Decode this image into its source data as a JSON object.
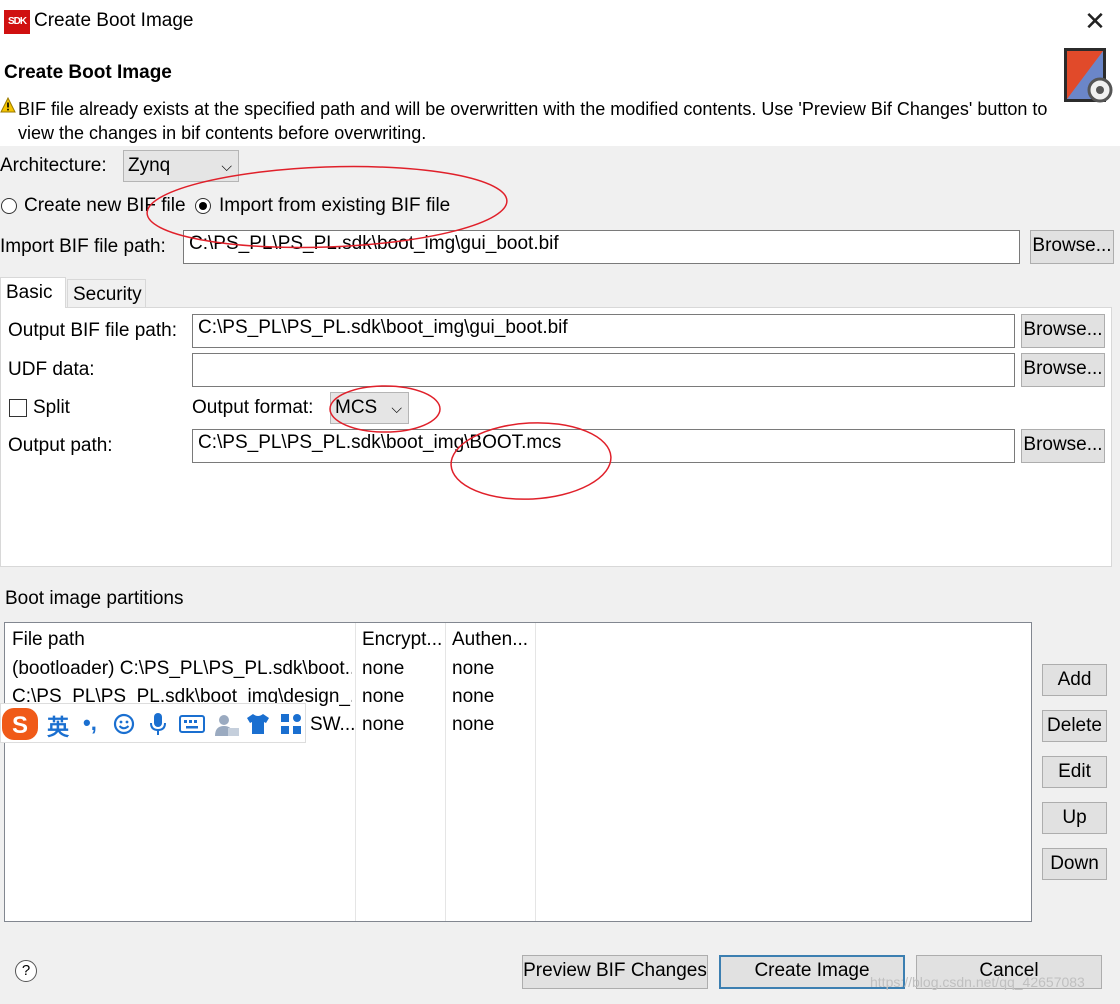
{
  "window": {
    "title": "Create Boot Image",
    "close_glyph": "✕"
  },
  "header": {
    "title": "Create Boot Image",
    "warning": "BIF file already exists at the specified path and will be overwritten with the modified contents. Use 'Preview Bif Changes' button to view the changes in bif contents before overwriting."
  },
  "architecture": {
    "label": "Architecture:",
    "value": "Zynq"
  },
  "mode": {
    "create_new_label": "Create new BIF file",
    "import_label": "Import from existing BIF file",
    "selected": "import"
  },
  "import_bif": {
    "label": "Import BIF file path:",
    "value": "C:\\PS_PL\\PS_PL.sdk\\boot_img\\gui_boot.bif",
    "browse": "Browse..."
  },
  "tabs": [
    {
      "label": "Basic",
      "active": true
    },
    {
      "label": "Security",
      "active": false
    }
  ],
  "basic": {
    "output_bif_label": "Output BIF file path:",
    "output_bif_value": "C:\\PS_PL\\PS_PL.sdk\\boot_img\\gui_boot.bif",
    "udf_label": "UDF data:",
    "udf_value": "",
    "split_label": "Split",
    "output_format_label": "Output format:",
    "output_format_value": "MCS",
    "output_path_label": "Output path:",
    "output_path_value": "C:\\PS_PL\\PS_PL.sdk\\boot_img\\BOOT.mcs",
    "browse": "Browse..."
  },
  "partitions": {
    "label": "Boot image partitions",
    "columns": [
      "File path",
      "Encrypt...",
      "Authen..."
    ],
    "rows": [
      [
        "(bootloader) C:\\PS_PL\\PS_PL.sdk\\boot...",
        "none",
        "none"
      ],
      [
        "C:\\PS_PL\\PS_PL.sdk\\boot_img\\design_...",
        "none",
        "none"
      ],
      [
        "SW...",
        "none",
        "none"
      ]
    ],
    "buttons": {
      "add": "Add",
      "delete": "Delete",
      "edit": "Edit",
      "up": "Up",
      "down": "Down"
    }
  },
  "ime_toolbar": {
    "lang": "英",
    "punct": "•,",
    "items": [
      "emoji-icon",
      "microphone-icon",
      "keyboard-icon",
      "user-icon",
      "skin-icon",
      "grid-icon"
    ]
  },
  "footer": {
    "help": "?",
    "preview": "Preview BIF Changes",
    "create": "Create Image",
    "cancel": "Cancel",
    "watermark": "https://blog.csdn.net/qq_42657083"
  },
  "colors": {
    "annotation_red": "#e0202a",
    "ime_orange": "#f05a18",
    "ime_blue": "#1a6fd0",
    "focus_blue": "#3c7fb1"
  }
}
